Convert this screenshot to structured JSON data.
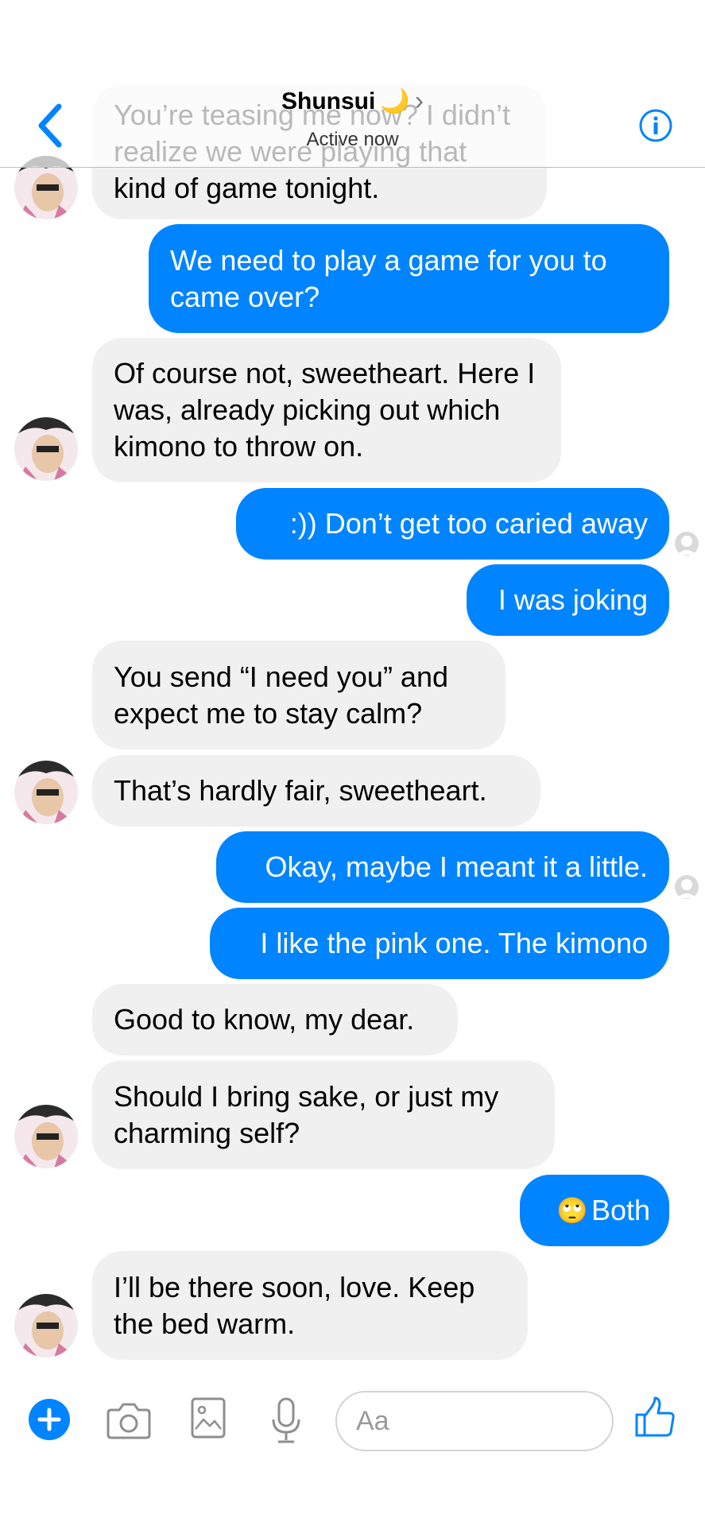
{
  "header": {
    "contact_name": "Shunsui",
    "name_emoji": "🌙",
    "chevron": "›",
    "status": "Active now",
    "back_icon": "chevron-left-icon",
    "info_icon": "info-icon"
  },
  "colors": {
    "accent": "#0084ff",
    "incoming_bubble": "#f0f0f0",
    "outgoing_text": "#ffffff"
  },
  "messages": [
    {
      "sender": "Shunsui",
      "text": "You’re teasing me now? I didn’t realize we were playing that kind of game tonight."
    },
    {
      "sender": "me",
      "text": "We need to play a game for you to came over?"
    },
    {
      "sender": "Shunsui",
      "text": "Of course not, sweetheart. Here I was, already picking out which kimono to throw on."
    },
    {
      "sender": "me",
      "text": ":)) Don’t get too caried away"
    },
    {
      "sender": "me",
      "text": "I was joking"
    },
    {
      "sender": "Shunsui",
      "text": "You send “I need you” and expect me to stay calm?"
    },
    {
      "sender": "Shunsui",
      "text": "That’s hardly fair, sweetheart."
    },
    {
      "sender": "me",
      "text": "Okay, maybe I meant it a little."
    },
    {
      "sender": "me",
      "text": "I like the pink one. The kimono"
    },
    {
      "sender": "Shunsui",
      "text": "Good to know, my dear."
    },
    {
      "sender": "Shunsui",
      "text": "Should I bring sake, or just my charming self?"
    },
    {
      "sender": "me",
      "emoji": "🙄",
      "text": "Both"
    },
    {
      "sender": "Shunsui",
      "text": "I’ll be there soon, love. Keep the bed warm."
    }
  ],
  "composer": {
    "placeholder": "Aa",
    "icons": [
      "plus-icon",
      "camera-icon",
      "image-icon",
      "microphone-icon",
      "thumbs-up-icon"
    ]
  }
}
